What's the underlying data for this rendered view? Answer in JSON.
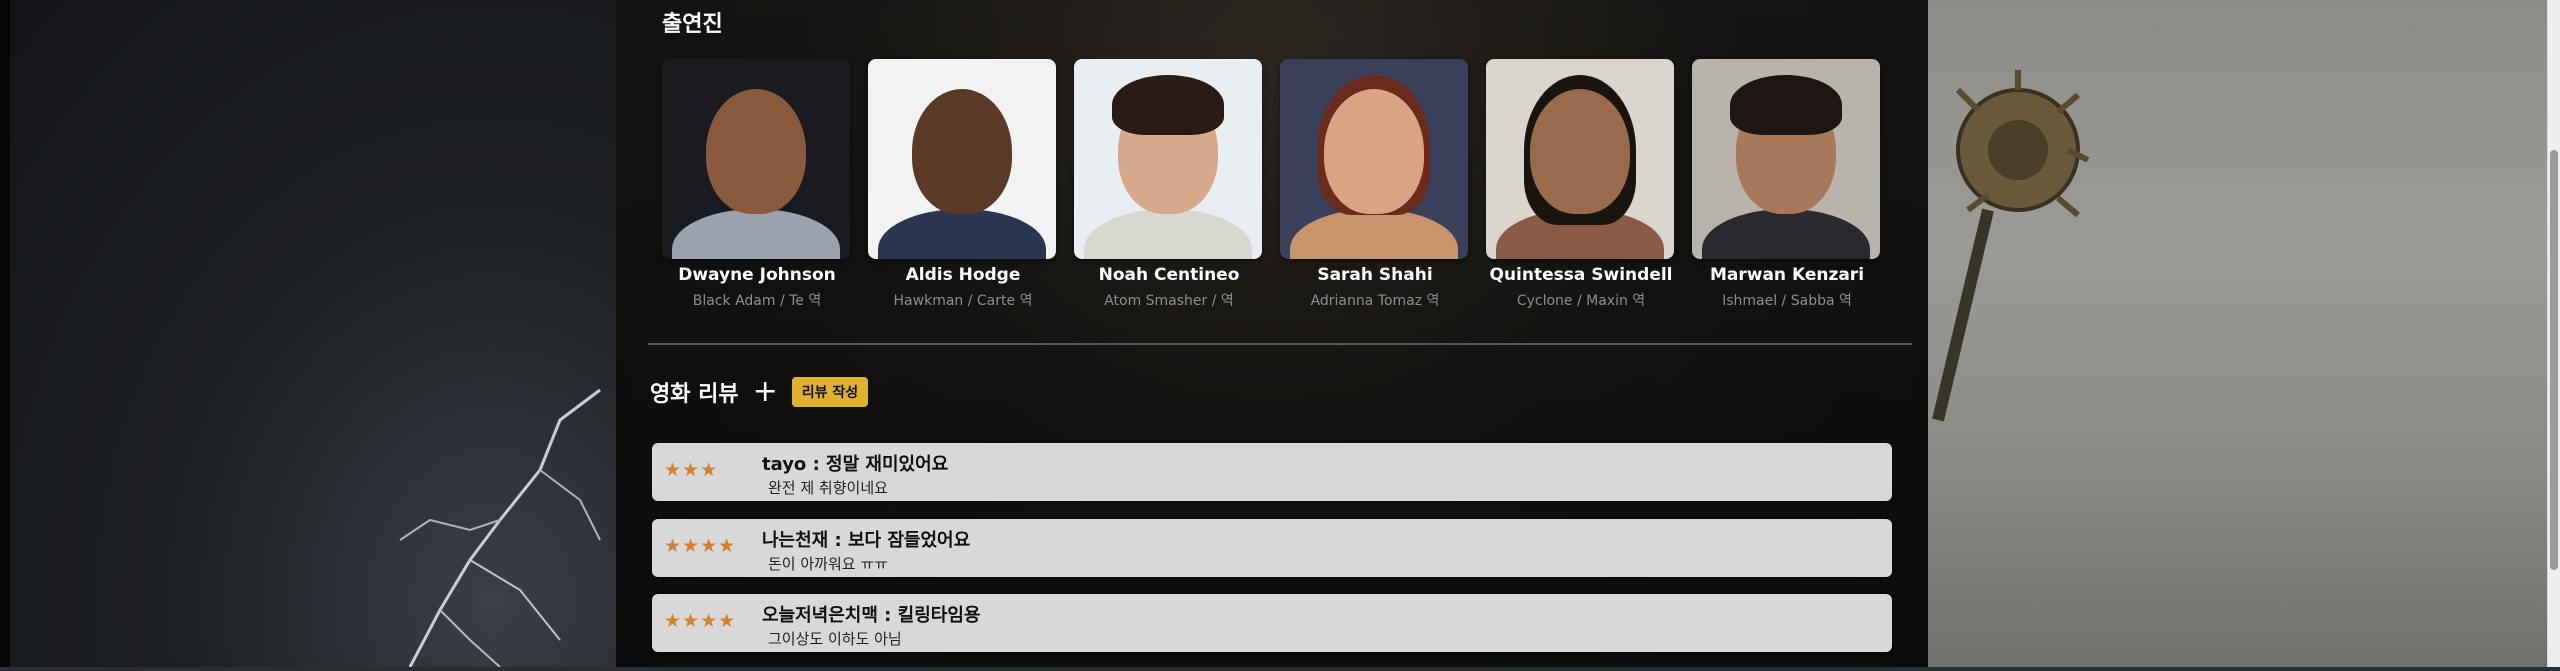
{
  "cast": {
    "title": "출연진",
    "members": [
      {
        "name": "Dwayne Johnson",
        "role": "Black Adam / Te 역"
      },
      {
        "name": "Aldis Hodge",
        "role": "Hawkman / Carte 역"
      },
      {
        "name": "Noah Centineo",
        "role": "Atom Smasher / 역"
      },
      {
        "name": "Sarah Shahi",
        "role": "Adrianna Tomaz 역"
      },
      {
        "name": "Quintessa Swindell",
        "role": "Cyclone / Maxin 역"
      },
      {
        "name": "Marwan Kenzari",
        "role": "Ishmael / Sabba 역"
      }
    ]
  },
  "reviews": {
    "title": "영화 리뷰",
    "plus_symbol": "+",
    "write_label": "리뷰 작성",
    "items": [
      {
        "stars": "★★★",
        "rating": 3,
        "line1": "tayo : 정말 재미있어요",
        "line2": "완전 제 취향이네요"
      },
      {
        "stars": "★★★★",
        "rating": 4,
        "line1": "나는천재 : 보다 잠들었어요",
        "line2": "돈이 아까워요 ㅠㅠ"
      },
      {
        "stars": "★★★★",
        "rating": 4,
        "line1": "오늘저녁은치맥 : 킬링타임용",
        "line2": "그이상도 이하도 아님"
      }
    ]
  },
  "colors": {
    "accent_button": "#e0b030",
    "star": "#d4802f",
    "review_card": "#d8d8d8"
  }
}
